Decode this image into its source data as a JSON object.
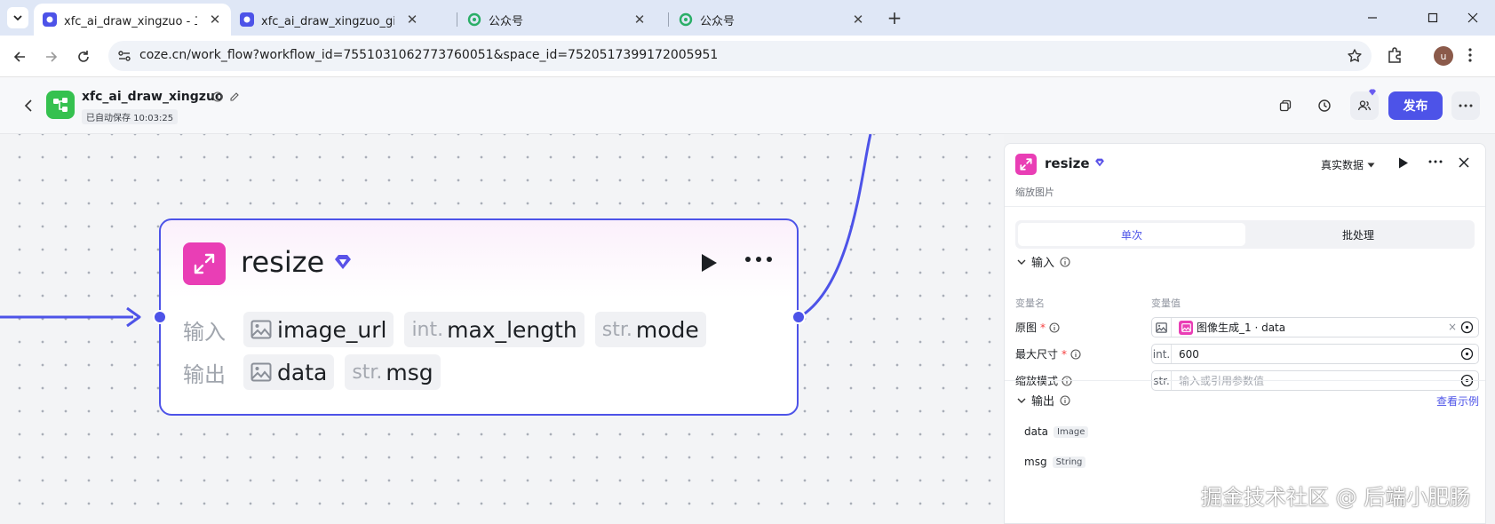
{
  "browser": {
    "tabs": [
      {
        "title": "xfc_ai_draw_xingzuo - 工作流",
        "active": true,
        "favicon": "coze-icon"
      },
      {
        "title": "xfc_ai_draw_xingzuo_gif - 工作",
        "active": false,
        "favicon": "coze-icon"
      },
      {
        "title": "公众号",
        "active": false,
        "favicon": "wechat-mp-icon"
      },
      {
        "title": "公众号",
        "active": false,
        "favicon": "wechat-mp-icon"
      }
    ],
    "url": "coze.cn/work_flow?workflow_id=7551031062773760051&space_id=7520517399172005951",
    "profile_initial": "u"
  },
  "header": {
    "workflow_name": "xfc_ai_draw_xingzuo",
    "autosave": "已自动保存 10:03:25",
    "publish_label": "发布"
  },
  "node": {
    "title": "resize",
    "input_label": "输入",
    "output_label": "输出",
    "inputs": [
      {
        "type": "",
        "name": "image_url",
        "icon": "image-icon"
      },
      {
        "type": "int.",
        "name": "max_length"
      },
      {
        "type": "str.",
        "name": "mode"
      }
    ],
    "outputs": [
      {
        "type": "",
        "name": "data",
        "icon": "image-icon"
      },
      {
        "type": "str.",
        "name": "msg"
      }
    ]
  },
  "panel": {
    "title": "resize",
    "subtitle": "缩放图片",
    "data_source": "真实数据",
    "tabs": [
      "单次",
      "批处理"
    ],
    "active_tab": 0,
    "input_section": "输入",
    "col_name": "变量名",
    "col_value": "变量值",
    "params": [
      {
        "name": "原图",
        "required": true,
        "type_icon": "image-icon",
        "value": "图像生成_1 · data",
        "placeholder": ""
      },
      {
        "name": "最大尺寸",
        "required": true,
        "type": "int.",
        "value": "600",
        "placeholder": ""
      },
      {
        "name": "缩放模式",
        "required": false,
        "type": "str.",
        "value": "",
        "placeholder": "输入或引用参数值"
      }
    ],
    "output_section": "输出",
    "see_example": "查看示例",
    "outputs": [
      {
        "name": "data",
        "type": "Image"
      },
      {
        "name": "msg",
        "type": "String"
      }
    ]
  },
  "watermark": "掘金技术社区 @ 后端小肥肠",
  "colors": {
    "accent": "#4d53e8",
    "node_icon": "#e93eb5",
    "workflow_logo": "#35c14f",
    "required": "#f53f3f"
  }
}
